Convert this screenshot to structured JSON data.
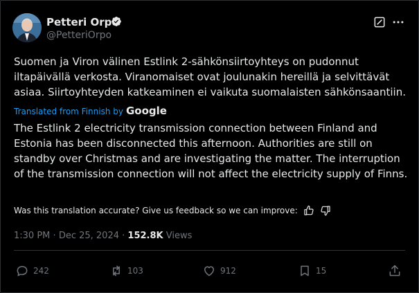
{
  "author": {
    "display_name": "Petteri Orpo",
    "handle": "@PetteriOrpo",
    "verified_icon": "verified-badge-icon"
  },
  "header_actions": [
    "grok-icon",
    "more-icon"
  ],
  "tweet": {
    "original_text": "Suomen ja Viron välinen Estlink 2-sähkönsiirtoyhteys on pudonnut iltapäivällä verkosta. Viranomaiset ovat joulunakin hereillä ja selvittävät asiaa. Siirtoyhteyden katkeaminen ei vaikuta suomalaisten sähkönsaantiin.",
    "translated_from": "Translated from Finnish by",
    "translation_provider": "Google",
    "translation_text": "The Estlink 2 electricity transmission connection between Finland and Estonia has been disconnected this afternoon. Authorities are still on standby over Christmas and are investigating the matter. The interruption of the transmission connection will not affect the electricity supply of Finns.",
    "feedback_prompt": "Was this translation accurate? Give us feedback so we can improve:"
  },
  "meta": {
    "time": "1:30 PM",
    "separator": "·",
    "date": "Dec 25, 2024",
    "views_count": "152.8K",
    "views_label": "Views"
  },
  "actions": {
    "replies": "242",
    "reposts": "103",
    "likes": "912",
    "bookmarks": "15"
  },
  "colors": {
    "background": "#000000",
    "text": "#e7e9ea",
    "muted": "#71767b",
    "accent": "#1d9bf0"
  }
}
